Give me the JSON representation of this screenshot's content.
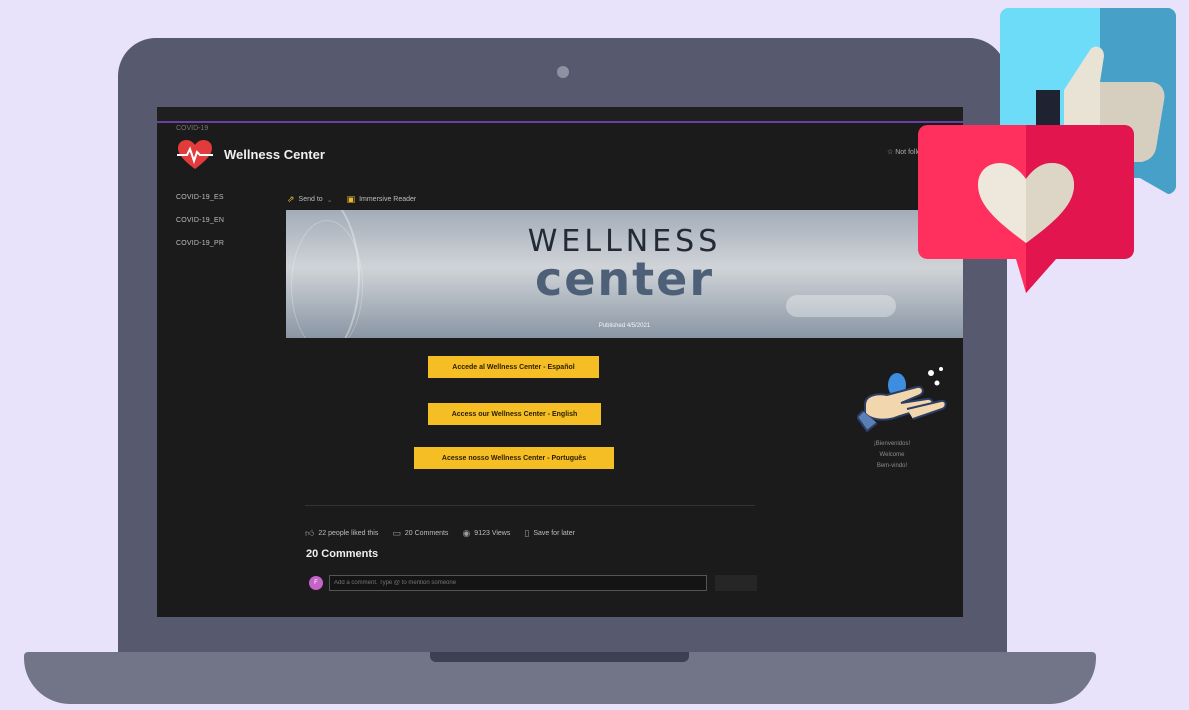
{
  "app": {
    "site_tag": "COVID-19",
    "title": "Wellness Center",
    "follow_label": "Not following",
    "colors": {
      "accent": "#f5be24",
      "divider": "#6b3fa8",
      "background": "#1b1b1b",
      "heart": "#e3154e",
      "like": "#6ddcf8"
    }
  },
  "nav": {
    "items": [
      {
        "label": "COVID-19_ES"
      },
      {
        "label": "COVID-19_EN"
      },
      {
        "label": "COVID-19_PR"
      }
    ]
  },
  "commands": {
    "send_to": "Send to",
    "immersive_reader": "Immersive Reader"
  },
  "banner": {
    "title": "WELLNESS",
    "subtitle": "center",
    "date": "Published 4/5/2021"
  },
  "buttons": {
    "es": "Accede al Wellness Center - Español",
    "en": "Access our Wellness Center - English",
    "pt": "Acesse nosso Wellness Center - Português"
  },
  "welcome": {
    "line1": "¡Bienvenidos!",
    "line2": "Welcome",
    "line3": "Bem-vindo!"
  },
  "social": {
    "likes": "22 people liked this",
    "comments": "20 Comments",
    "views": "9123 Views",
    "save": "Save for later"
  },
  "comments": {
    "title": "20 Comments",
    "avatar_initial": "F",
    "placeholder": "Add a comment. Type @ to mention someone"
  },
  "icons": {
    "logo": "heart-pulse-icon",
    "like_reaction": "thumbs-up-icon",
    "love_reaction": "heart-icon",
    "hands": "hand-washing-icon"
  }
}
